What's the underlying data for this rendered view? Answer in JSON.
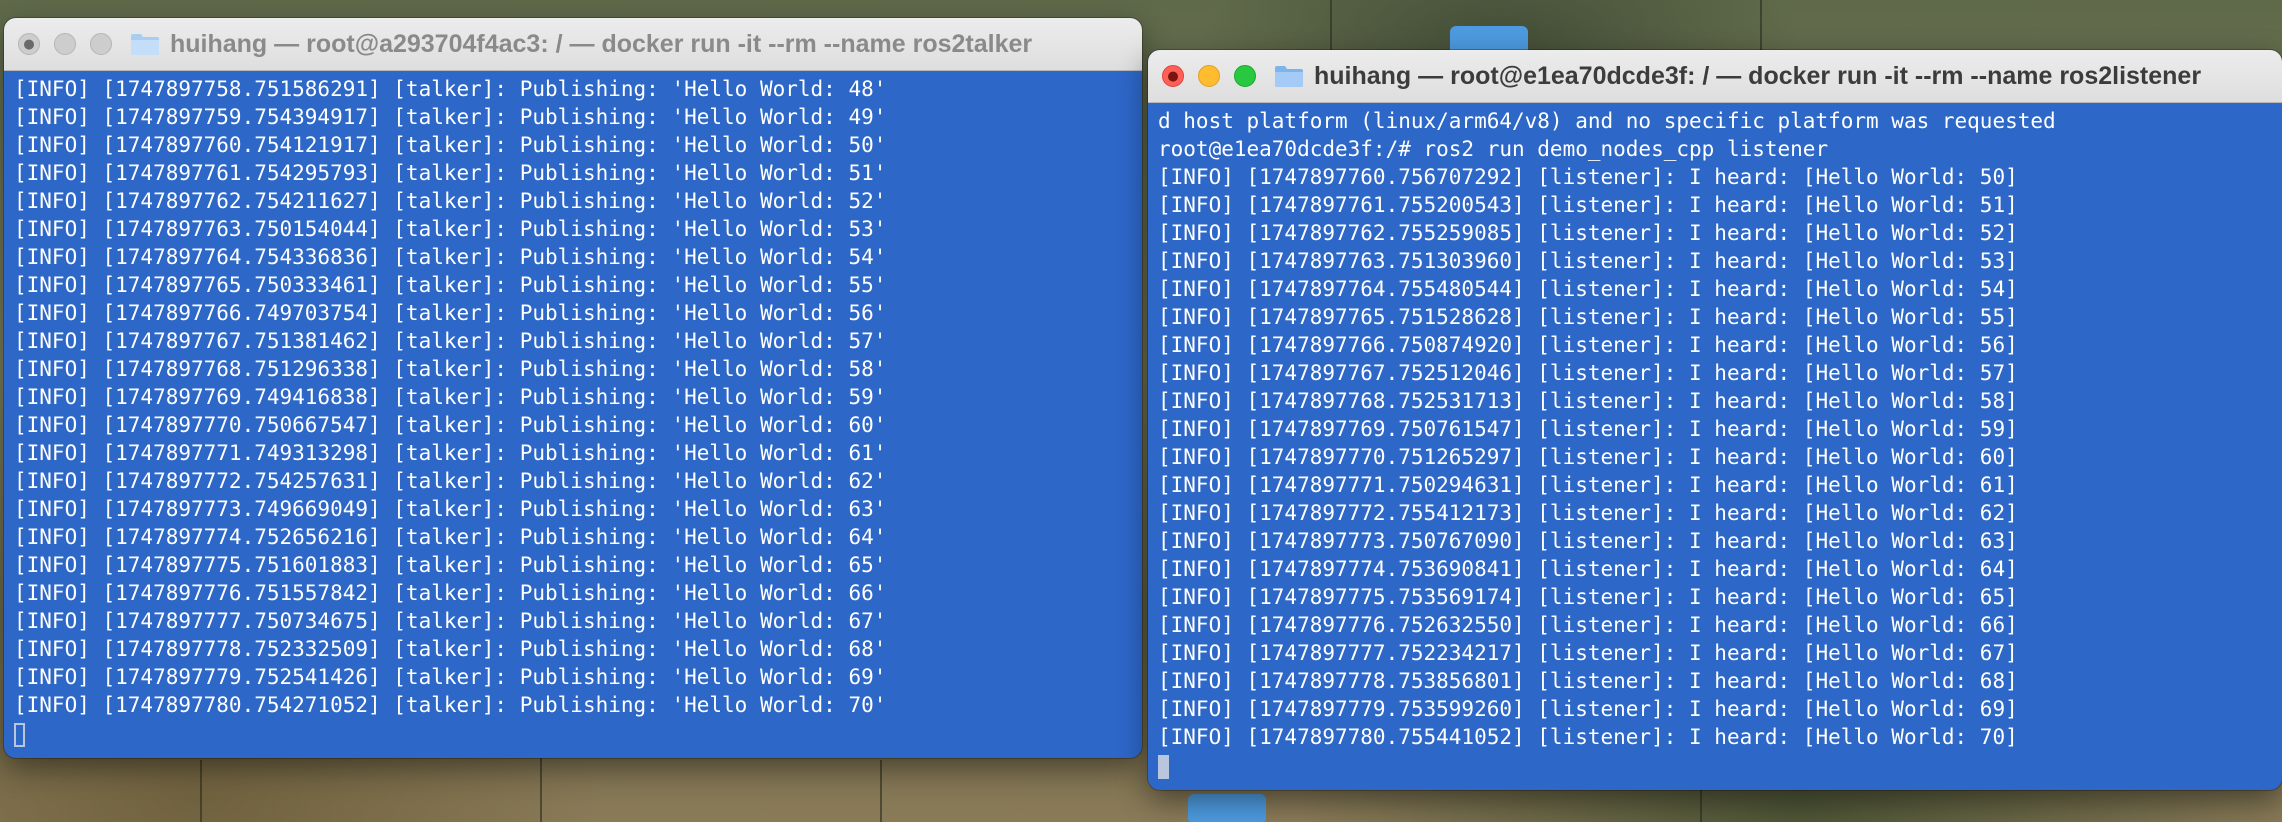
{
  "talker": {
    "title": "huihang — root@a293704f4ac3: / — docker run -it --rm --name ros2talker",
    "lines": [
      "[INFO] [1747897758.751586291] [talker]: Publishing: 'Hello World: 48'",
      "[INFO] [1747897759.754394917] [talker]: Publishing: 'Hello World: 49'",
      "[INFO] [1747897760.754121917] [talker]: Publishing: 'Hello World: 50'",
      "[INFO] [1747897761.754295793] [talker]: Publishing: 'Hello World: 51'",
      "[INFO] [1747897762.754211627] [talker]: Publishing: 'Hello World: 52'",
      "[INFO] [1747897763.750154044] [talker]: Publishing: 'Hello World: 53'",
      "[INFO] [1747897764.754336836] [talker]: Publishing: 'Hello World: 54'",
      "[INFO] [1747897765.750333461] [talker]: Publishing: 'Hello World: 55'",
      "[INFO] [1747897766.749703754] [talker]: Publishing: 'Hello World: 56'",
      "[INFO] [1747897767.751381462] [talker]: Publishing: 'Hello World: 57'",
      "[INFO] [1747897768.751296338] [talker]: Publishing: 'Hello World: 58'",
      "[INFO] [1747897769.749416838] [talker]: Publishing: 'Hello World: 59'",
      "[INFO] [1747897770.750667547] [talker]: Publishing: 'Hello World: 60'",
      "[INFO] [1747897771.749313298] [talker]: Publishing: 'Hello World: 61'",
      "[INFO] [1747897772.754257631] [talker]: Publishing: 'Hello World: 62'",
      "[INFO] [1747897773.749669049] [talker]: Publishing: 'Hello World: 63'",
      "[INFO] [1747897774.752656216] [talker]: Publishing: 'Hello World: 64'",
      "[INFO] [1747897775.751601883] [talker]: Publishing: 'Hello World: 65'",
      "[INFO] [1747897776.751557842] [talker]: Publishing: 'Hello World: 66'",
      "[INFO] [1747897777.750734675] [talker]: Publishing: 'Hello World: 67'",
      "[INFO] [1747897778.752332509] [talker]: Publishing: 'Hello World: 68'",
      "[INFO] [1747897779.752541426] [talker]: Publishing: 'Hello World: 69'",
      "[INFO] [1747897780.754271052] [talker]: Publishing: 'Hello World: 70'"
    ]
  },
  "listener": {
    "title": "huihang — root@e1ea70dcde3f: / — docker run -it --rm --name ros2listener",
    "lines": [
      "d host platform (linux/arm64/v8) and no specific platform was requested",
      "root@e1ea70dcde3f:/# ros2 run demo_nodes_cpp listener",
      "[INFO] [1747897760.756707292] [listener]: I heard: [Hello World: 50]",
      "[INFO] [1747897761.755200543] [listener]: I heard: [Hello World: 51]",
      "[INFO] [1747897762.755259085] [listener]: I heard: [Hello World: 52]",
      "[INFO] [1747897763.751303960] [listener]: I heard: [Hello World: 53]",
      "[INFO] [1747897764.755480544] [listener]: I heard: [Hello World: 54]",
      "[INFO] [1747897765.751528628] [listener]: I heard: [Hello World: 55]",
      "[INFO] [1747897766.750874920] [listener]: I heard: [Hello World: 56]",
      "[INFO] [1747897767.752512046] [listener]: I heard: [Hello World: 57]",
      "[INFO] [1747897768.752531713] [listener]: I heard: [Hello World: 58]",
      "[INFO] [1747897769.750761547] [listener]: I heard: [Hello World: 59]",
      "[INFO] [1747897770.751265297] [listener]: I heard: [Hello World: 60]",
      "[INFO] [1747897771.750294631] [listener]: I heard: [Hello World: 61]",
      "[INFO] [1747897772.755412173] [listener]: I heard: [Hello World: 62]",
      "[INFO] [1747897773.750767090] [listener]: I heard: [Hello World: 63]",
      "[INFO] [1747897774.753690841] [listener]: I heard: [Hello World: 64]",
      "[INFO] [1747897775.753569174] [listener]: I heard: [Hello World: 65]",
      "[INFO] [1747897776.752632550] [listener]: I heard: [Hello World: 66]",
      "[INFO] [1747897777.752234217] [listener]: I heard: [Hello World: 67]",
      "[INFO] [1747897778.753856801] [listener]: I heard: [Hello World: 68]",
      "[INFO] [1747897779.753599260] [listener]: I heard: [Hello World: 69]",
      "[INFO] [1747897780.755441052] [listener]: I heard: [Hello World: 70]"
    ]
  },
  "colors": {
    "terminal_bg": "#2d67c8",
    "terminal_text": "#ffffff",
    "close": "#fe5f57",
    "minimize": "#febc2e",
    "zoom": "#28c840"
  },
  "icons": [
    "folder-icon",
    "close-icon",
    "minimize-icon",
    "zoom-icon"
  ]
}
